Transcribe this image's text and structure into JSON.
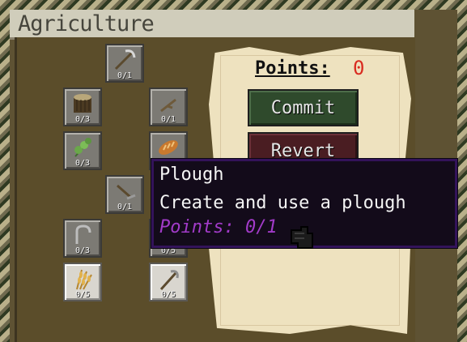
{
  "window": {
    "title": "Agriculture"
  },
  "skills": [
    {
      "name": "scythe",
      "count": "0/1",
      "icon": "scythe-icon"
    },
    {
      "name": "log",
      "count": "0/3",
      "icon": "log-icon"
    },
    {
      "name": "stick",
      "count": "0/1",
      "icon": "stick-icon"
    },
    {
      "name": "sapling",
      "count": "0/3",
      "icon": "sapling-icon"
    },
    {
      "name": "bread",
      "count": "",
      "icon": "bread-icon"
    },
    {
      "name": "plough",
      "count": "0/1",
      "icon": "plough-icon"
    },
    {
      "name": "hook",
      "count": "0/3",
      "icon": "hook-icon"
    },
    {
      "name": "hidden",
      "count": "0/5",
      "icon": "tool-icon"
    },
    {
      "name": "wheat",
      "count": "0/5",
      "icon": "wheat-icon"
    },
    {
      "name": "sickle",
      "count": "0/5",
      "icon": "sickle-icon"
    }
  ],
  "points_panel": {
    "label": "Points:",
    "value": "0"
  },
  "buttons": {
    "commit": "Commit",
    "revert": "Revert"
  },
  "tooltip": {
    "title": "Plough",
    "description": "Create and use a plough",
    "points": "Points: 0/1"
  },
  "colors": {
    "panel": "#5b4d2a",
    "parchment": "#eee2bf",
    "commit": "#2f4a2c",
    "revert": "#4a1d22",
    "tooltip_bg": "#130b1a",
    "tooltip_border": "#33135a",
    "points_value": "#d92b20",
    "tooltip_points": "#a23bc9"
  }
}
